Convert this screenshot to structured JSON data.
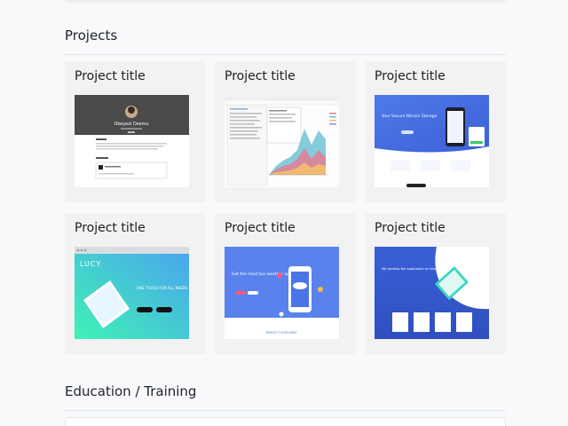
{
  "projects": {
    "heading": "Projects",
    "items": [
      {
        "title": "Project title",
        "thumb": "profile-page",
        "name_text": "Okeyezi Osemu"
      },
      {
        "title": "Project title",
        "thumb": "chart-dashboard"
      },
      {
        "title": "Project title",
        "thumb": "bitcoin-landing",
        "hero_text": "Your Secure Bitcoin Storage"
      },
      {
        "title": "Project title",
        "thumb": "lucy-app",
        "brand_text": "LUCY",
        "hero_text": "ONE TOUCH FOR ALL NEEDS"
      },
      {
        "title": "Project title",
        "thumb": "weather-app",
        "hero_text": "Get the most fun weather app",
        "footer_text": "PERFECT FEATURES"
      },
      {
        "title": "Project title",
        "thumb": "business-app",
        "hero_text": "We develop the application to help people's business"
      }
    ]
  },
  "education": {
    "heading": "Education / Training"
  },
  "colors": {
    "background": "#f8f9fb",
    "card": "#f2f2f3",
    "divider": "#e2e5e9",
    "blue": "#4a74e8",
    "teal": "#3fd6c0"
  }
}
